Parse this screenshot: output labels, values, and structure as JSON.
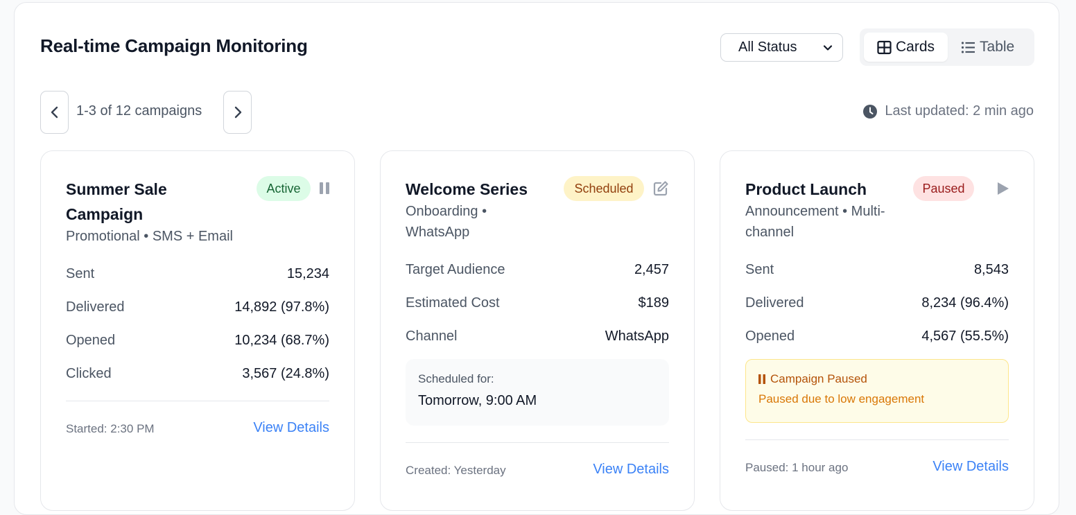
{
  "header": {
    "title": "Real-time Campaign Monitoring",
    "status_filter": "All Status",
    "views": [
      {
        "label": "Cards",
        "icon": "grid-icon",
        "active": true
      },
      {
        "label": "Table",
        "icon": "list-icon",
        "active": false
      }
    ]
  },
  "pagination": {
    "text": "1-3 of 12 campaigns",
    "last_updated": "Last updated: 2 min ago"
  },
  "colors": {
    "active_badge_bg": "#dcfce7",
    "scheduled_badge_bg": "#fef3c7",
    "paused_badge_bg": "#fee2e2",
    "link": "#3b82f6"
  },
  "cards": [
    {
      "title_line1": "Summer Sale",
      "title_line2": "Campaign",
      "subtitle": "Promotional • SMS + Email",
      "status": "Active",
      "action_icon": "pause-icon",
      "metrics": [
        {
          "label": "Sent",
          "value": "15,234"
        },
        {
          "label": "Delivered",
          "value": "14,892 (97.8%)"
        },
        {
          "label": "Opened",
          "value": "10,234 (68.7%)"
        },
        {
          "label": "Clicked",
          "value": "3,567 (24.8%)"
        }
      ],
      "footer": "Started: 2:30 PM",
      "link": "View Details"
    },
    {
      "title_line1": "Welcome Series",
      "subtitle_line1": "Onboarding •",
      "subtitle_line2": "WhatsApp",
      "status": "Scheduled",
      "action_icon": "edit-icon",
      "metrics": [
        {
          "label": "Target Audience",
          "value": "2,457"
        },
        {
          "label": "Estimated Cost",
          "value": "$189"
        },
        {
          "label": "Channel",
          "value": "WhatsApp"
        }
      ],
      "schedule_label": "Scheduled for:",
      "schedule_value": "Tomorrow, 9:00 AM",
      "footer": "Created: Yesterday",
      "link": "View Details"
    },
    {
      "title_line1": "Product Launch",
      "subtitle_line1": "Announcement • Multi-",
      "subtitle_line2": "channel",
      "status": "Paused",
      "action_icon": "play-icon",
      "metrics": [
        {
          "label": "Sent",
          "value": "8,543"
        },
        {
          "label": "Delivered",
          "value": "8,234 (96.4%)"
        },
        {
          "label": "Opened",
          "value": "4,567 (55.5%)"
        }
      ],
      "alert_title": "Campaign Paused",
      "alert_desc": "Paused due to low engagement",
      "footer": "Paused: 1 hour ago",
      "link": "View Details"
    }
  ]
}
